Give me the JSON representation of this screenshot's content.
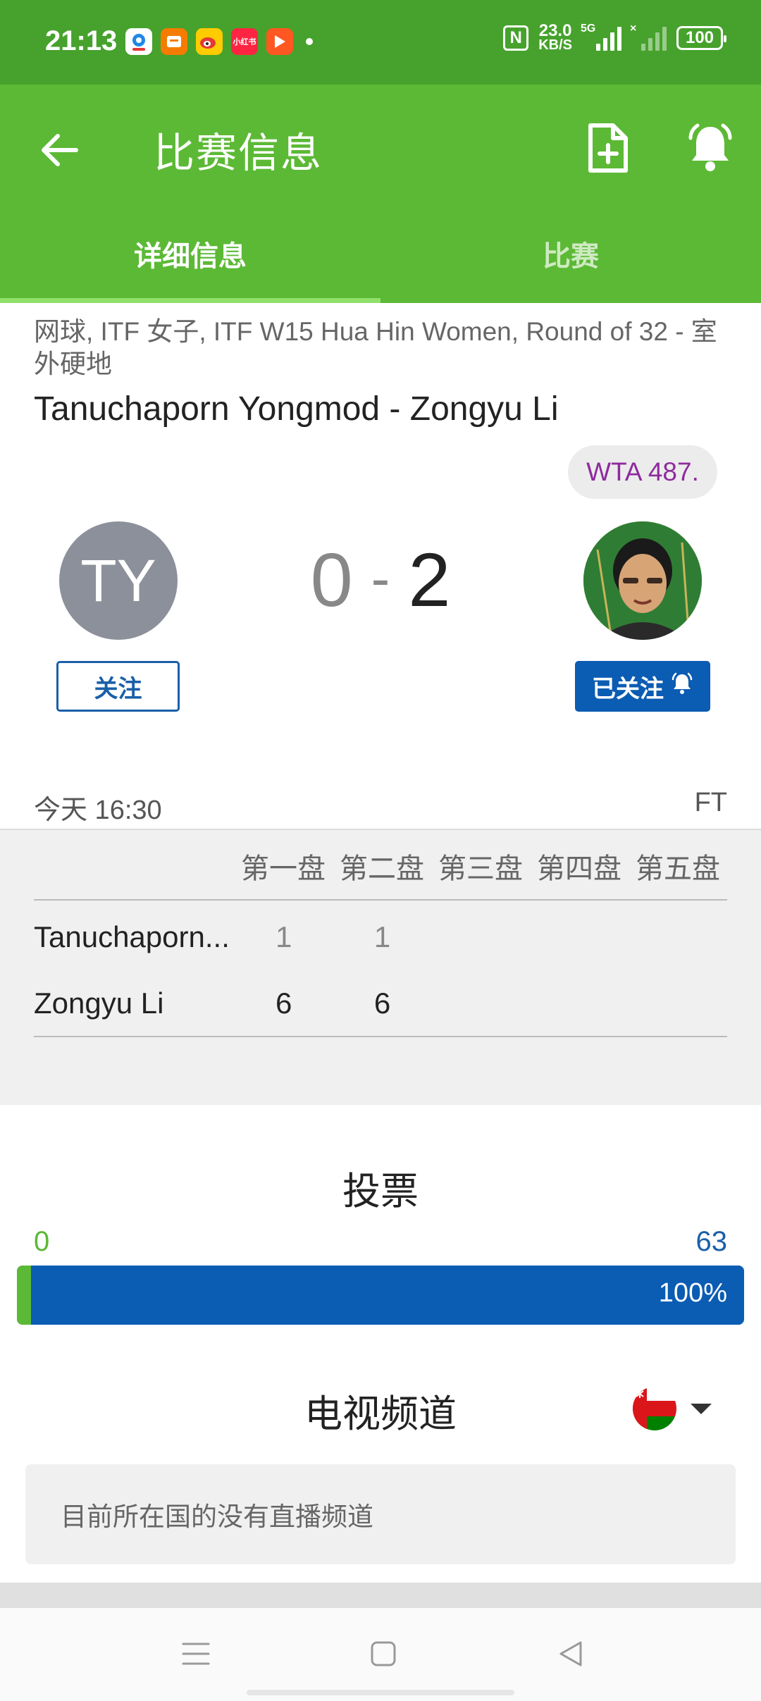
{
  "status_bar": {
    "time": "21:13",
    "nfc": "N",
    "net_speed_value": "23.0",
    "net_speed_unit": "KB/S",
    "sim1_tag": "5G",
    "sim2_tag": "×",
    "battery": "100",
    "apps": [
      "app-blue-icon",
      "app-orange-icon",
      "weibo-icon",
      "xiaohongshu-icon",
      "video-play-icon"
    ],
    "app_small_label": "小红书"
  },
  "header": {
    "title": "比赛信息",
    "tabs": [
      {
        "label": "详细信息",
        "active": true
      },
      {
        "label": "比赛",
        "active": false
      }
    ]
  },
  "match": {
    "breadcrumb": "网球, ITF 女子, ITF W15 Hua Hin Women, Round of 32 - 室外硬地",
    "title": "Tanuchaporn Yongmod - Zongyu Li",
    "away_rank": "WTA 487.",
    "home_initials": "TY",
    "home_score": "0",
    "score_sep": "-",
    "away_score": "2",
    "home_follow": "关注",
    "away_follow": "已关注",
    "time": "今天 16:30",
    "status": "FT"
  },
  "sets": {
    "headers": [
      "第一盘",
      "第二盘",
      "第三盘",
      "第四盘",
      "第五盘"
    ],
    "rows": [
      {
        "name": "Tanuchaporn...",
        "scores": [
          "1",
          "1",
          "",
          "",
          ""
        ]
      },
      {
        "name": "Zongyu Li",
        "scores": [
          "6",
          "6",
          "",
          "",
          ""
        ]
      }
    ]
  },
  "vote": {
    "title": "投票",
    "home_count": "0",
    "away_count": "63",
    "away_percent": "100%",
    "away_fraction": 1.0
  },
  "tv": {
    "title": "电视频道",
    "flag": "oman-flag-icon",
    "message": "目前所在国的没有直播频道"
  },
  "colors": {
    "status_green": "#46a22c",
    "header_green": "#5cb935",
    "accent_blue": "#0b5cb3",
    "rank_purple": "#8e2b9e"
  }
}
